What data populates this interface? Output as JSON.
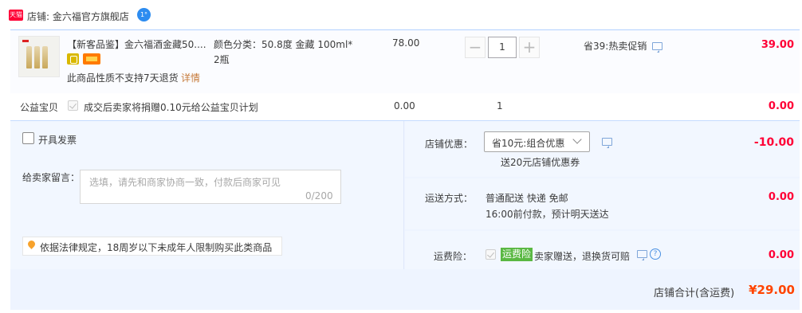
{
  "shop": {
    "logo_text": "天猫",
    "label": "店铺: 金六福官方旗舰店",
    "ww_icon_text": "1°"
  },
  "item": {
    "title": "【新客品鉴】金六福酒金藏50....",
    "spec_line1": "颜色分类：50.8度 金藏 100ml*",
    "spec_line2": "2瓶",
    "no_return": "此商品性质不支持7天退货",
    "detail_link": "详情",
    "price": "78.00",
    "qty_minus": "−",
    "qty_value": "1",
    "qty_plus": "+",
    "promo": "省39:热卖促销",
    "subtotal": "39.00"
  },
  "charity": {
    "label": "公益宝贝",
    "text": "成交后卖家将捐赠0.10元给公益宝贝计划",
    "price": "0.00",
    "qty": "1",
    "subtotal": "0.00"
  },
  "invoice": {
    "label": "开具发票"
  },
  "message": {
    "label": "给卖家留言：",
    "placeholder": "选填，请先和商家协商一致，付款后商家可见",
    "count": "0/200"
  },
  "notice": {
    "text": "依据法律规定，18周岁以下未成年人限制购买此类商品"
  },
  "discount": {
    "label": "店铺优惠：",
    "selected": "省10元:组合优惠",
    "coupon_note": "送20元店铺优惠券",
    "value": "-10.00"
  },
  "shipping": {
    "label": "运送方式：",
    "line1": "普通配送 快递 免邮",
    "line2": "16:00前付款，预计明天送达",
    "value": "0.00"
  },
  "insurance": {
    "label": "运费险：",
    "tag": "运费险",
    "text": "卖家赠送，退换货可赔",
    "question": "?",
    "value": "0.00"
  },
  "total": {
    "label": "店铺合计(含运费)",
    "value": "¥29.00"
  },
  "colors": {
    "accent_red": "#ff0036",
    "total_orange": "#ff4400",
    "panel_blue": "#f2f7ff",
    "tag_green": "#5ab843"
  }
}
